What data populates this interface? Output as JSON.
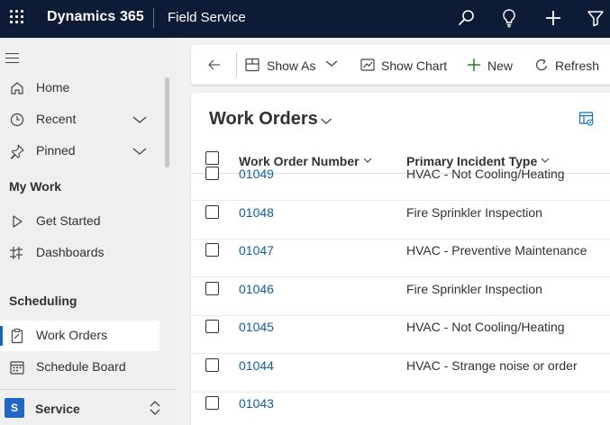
{
  "app": {
    "brand": "Dynamics 365",
    "module": "Field Service"
  },
  "topbar": {
    "icons": [
      "waffle-icon",
      "search-icon",
      "lightbulb-icon",
      "plus-icon",
      "filter-icon"
    ]
  },
  "sidebar": {
    "items": [
      {
        "label": "Home",
        "icon": "home-icon"
      },
      {
        "label": "Recent",
        "icon": "clock-icon",
        "expandable": true
      },
      {
        "label": "Pinned",
        "icon": "pin-icon",
        "expandable": true
      }
    ],
    "sections": [
      {
        "title": "My Work",
        "items": [
          {
            "label": "Get Started",
            "icon": "play-icon"
          },
          {
            "label": "Dashboards",
            "icon": "dashboard-icon"
          }
        ]
      },
      {
        "title": "Scheduling",
        "items": [
          {
            "label": "Work Orders",
            "icon": "clipboard-icon",
            "active": true
          },
          {
            "label": "Schedule Board",
            "icon": "calendar-icon"
          }
        ]
      }
    ],
    "area": {
      "badge": "S",
      "label": "Service"
    }
  },
  "commandbar": {
    "show_as": "Show As",
    "show_chart": "Show Chart",
    "new": "New",
    "refresh": "Refresh"
  },
  "view": {
    "title": "Work Orders",
    "columns": [
      "Work Order Number",
      "Primary Incident Type"
    ],
    "rows": [
      {
        "number": "01049",
        "incident": "HVAC - Not Cooling/Heating"
      },
      {
        "number": "01048",
        "incident": "Fire Sprinkler Inspection"
      },
      {
        "number": "01047",
        "incident": "HVAC - Preventive Maintenance"
      },
      {
        "number": "01046",
        "incident": "Fire Sprinkler Inspection"
      },
      {
        "number": "01045",
        "incident": "HVAC - Not Cooling/Heating"
      },
      {
        "number": "01044",
        "incident": "HVAC - Strange noise or order"
      },
      {
        "number": "01043",
        "incident": ""
      }
    ]
  },
  "colors": {
    "topbar": "#0d1b36",
    "accent": "#0f6cbd",
    "link": "#115ea3",
    "new_plus": "#107c10"
  }
}
